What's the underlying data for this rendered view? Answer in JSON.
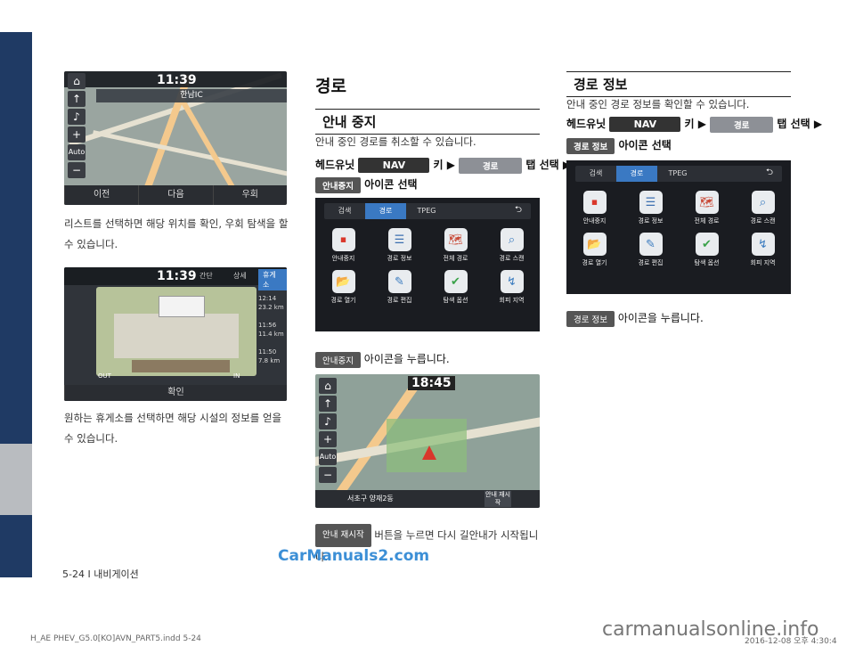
{
  "shot1": {
    "time": "11:39",
    "title": "한남IC",
    "buttons": [
      "이전",
      "다음",
      "우회"
    ],
    "left_buttons": [
      "⌂",
      "✈",
      "🔊",
      "+",
      "Auto",
      "−"
    ]
  },
  "caption1": "리스트를 선택하면 해당 위치를 확인, 우회 탐색을 할 수 있습니다.",
  "shot2": {
    "time": "11:39",
    "tabs": [
      "간단",
      "상세",
      "휴게소"
    ],
    "confirm": "확인",
    "side_values": [
      "12:14",
      "23.2 km",
      "11:56",
      "11.4 km",
      "11:50",
      "7.8 km"
    ],
    "out": "OUT",
    "in": "IN"
  },
  "caption2": "원하는 휴게소를 선택하면 해당 시설의 정보를 얻을 수 있습니다.",
  "mid": {
    "title": "경로",
    "section": "안내 중지",
    "desc": "안내 중인 경로를 취소할 수 있습니다.",
    "prefix": "헤드유닛",
    "nav": "NAV",
    "key": "키",
    "tab_pill": "경로",
    "tab_sel": "탭 선택",
    "icon_pill": "안내중지",
    "icon_sel": "아이콘 선택",
    "press_pill": "안내중지",
    "press_text": "아이콘을 누릅니다.",
    "resume_pill": "안내 재시작",
    "resume_text": "버튼을 누르면 다시 길안내가 시작됩니다.",
    "nav_time": "18:45",
    "nav_dest": "서초구 양재2동",
    "nav_btn": "안내 재시작"
  },
  "menu": {
    "tabs": [
      "검색",
      "경로",
      "TPEG"
    ],
    "items": [
      "안내중지",
      "경로 정보",
      "전체 경로",
      "경로 스캔",
      "경로 열기",
      "경로 편집",
      "탐색 옵션",
      "회피 지역"
    ],
    "icons": [
      "⏹",
      "☰",
      "🗺",
      "⌕",
      "📂",
      "✎",
      "✔",
      "↯"
    ],
    "icon_colors": [
      "#d9372b",
      "#3c6fb0",
      "#c94b39",
      "#3a7bbf",
      "#e08a2a",
      "#3a7bbf",
      "#3aa24a",
      "#3a7bbf"
    ]
  },
  "right": {
    "section": "경로 정보",
    "desc": "안내 중인 경로 정보를 확인할 수 있습니다.",
    "prefix": "헤드유닛",
    "nav": "NAV",
    "key": "키",
    "tab_pill": "경로",
    "tab_sel": "탭 선택",
    "icon_pill": "경로 정보",
    "icon_sel": "아이콘 선택",
    "press_pill": "경로 정보",
    "press_text": "아이콘을 누릅니다."
  },
  "footer": "5-24 I 내비게이션",
  "watermark": "CarManuals2.com",
  "watermark2": "carmanualsonline.info",
  "file_info": "H_AE PHEV_G5.0[KO]AVN_PART5.indd   5-24",
  "file_date": "2016-12-08   오후 4:30:4"
}
